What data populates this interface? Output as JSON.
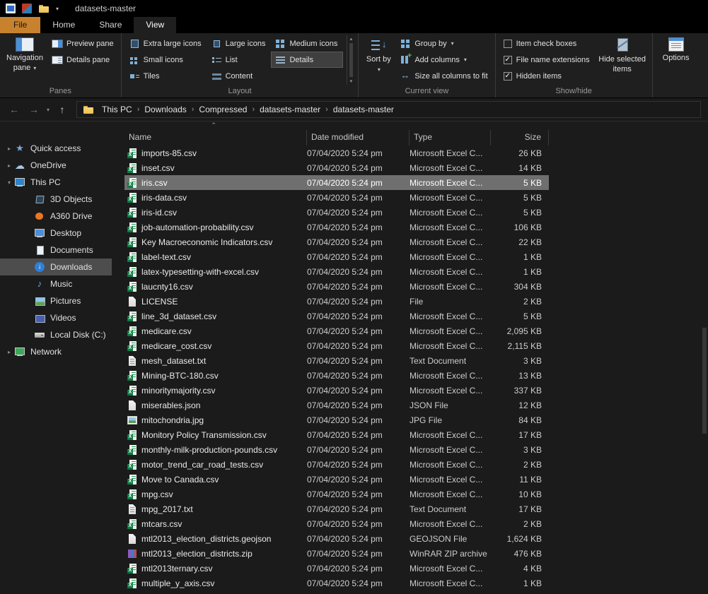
{
  "titlebar": {
    "title": "datasets-master"
  },
  "icons": {
    "back": "←",
    "forward": "→",
    "up": "↑",
    "dropdown": "▾",
    "crumb_sep": "›",
    "tree_down": "▾",
    "tree_right": "▸",
    "sort_asc": "ˆ",
    "check": "✓",
    "scroll_up": "▴",
    "scroll_down": "▾"
  },
  "ribbon": {
    "tabs": [
      {
        "label": "File",
        "style": "file"
      },
      {
        "label": "Home",
        "style": "normal"
      },
      {
        "label": "Share",
        "style": "normal"
      },
      {
        "label": "View",
        "style": "active"
      }
    ],
    "panes": {
      "label": "Panes",
      "nav_pane": "Navigation pane",
      "preview_pane": "Preview pane",
      "details_pane": "Details pane"
    },
    "layout": {
      "label": "Layout",
      "items": [
        {
          "label": "Extra large icons",
          "selected": false
        },
        {
          "label": "Large icons",
          "selected": false
        },
        {
          "label": "Medium icons",
          "selected": false
        },
        {
          "label": "Small icons",
          "selected": false
        },
        {
          "label": "List",
          "selected": false
        },
        {
          "label": "Details",
          "selected": true
        },
        {
          "label": "Tiles",
          "selected": false
        },
        {
          "label": "Content",
          "selected": false
        }
      ]
    },
    "current_view": {
      "label": "Current view",
      "sort_by": "Sort by",
      "group_by": "Group by",
      "add_columns": "Add columns",
      "size_all": "Size all columns to fit"
    },
    "show_hide": {
      "label": "Show/hide",
      "checkboxes": [
        {
          "label": "Item check boxes",
          "checked": false
        },
        {
          "label": "File name extensions",
          "checked": true
        },
        {
          "label": "Hidden items",
          "checked": true
        }
      ],
      "hide_selected": "Hide selected items"
    },
    "options": {
      "button": "Options"
    }
  },
  "address": {
    "breadcrumb": [
      "This PC",
      "Downloads",
      "Compressed",
      "datasets-master",
      "datasets-master"
    ]
  },
  "sidebar": {
    "items": [
      {
        "label": "Quick access",
        "icon": "star",
        "level": 0,
        "chevron": "right"
      },
      {
        "label": "OneDrive",
        "icon": "cloud",
        "level": 0,
        "chevron": "right"
      },
      {
        "label": "This PC",
        "icon": "pc",
        "level": 0,
        "chevron": "down"
      },
      {
        "label": "3D Objects",
        "icon": "cube",
        "level": 1
      },
      {
        "label": "A360 Drive",
        "icon": "a360",
        "level": 1
      },
      {
        "label": "Desktop",
        "icon": "desktop",
        "level": 1
      },
      {
        "label": "Documents",
        "icon": "documents",
        "level": 1
      },
      {
        "label": "Downloads",
        "icon": "downloads",
        "level": 1,
        "selected": true
      },
      {
        "label": "Music",
        "icon": "music",
        "level": 1
      },
      {
        "label": "Pictures",
        "icon": "pictures",
        "level": 1
      },
      {
        "label": "Videos",
        "icon": "videos",
        "level": 1
      },
      {
        "label": "Local Disk (C:)",
        "icon": "disk",
        "level": 1
      },
      {
        "label": "Network",
        "icon": "network",
        "level": 0,
        "chevron": "right"
      }
    ]
  },
  "filelist": {
    "columns": [
      "Name",
      "Date modified",
      "Type",
      "Size"
    ],
    "rows": [
      {
        "name": "imports-85.csv",
        "date": "07/04/2020 5:24 pm",
        "type": "Microsoft Excel C...",
        "size": "26 KB",
        "icon": "excel"
      },
      {
        "name": "inset.csv",
        "date": "07/04/2020 5:24 pm",
        "type": "Microsoft Excel C...",
        "size": "14 KB",
        "icon": "excel"
      },
      {
        "name": "iris.csv",
        "date": "07/04/2020 5:24 pm",
        "type": "Microsoft Excel C...",
        "size": "5 KB",
        "icon": "excel",
        "selected": true
      },
      {
        "name": "iris-data.csv",
        "date": "07/04/2020 5:24 pm",
        "type": "Microsoft Excel C...",
        "size": "5 KB",
        "icon": "excel"
      },
      {
        "name": "iris-id.csv",
        "date": "07/04/2020 5:24 pm",
        "type": "Microsoft Excel C...",
        "size": "5 KB",
        "icon": "excel"
      },
      {
        "name": "job-automation-probability.csv",
        "date": "07/04/2020 5:24 pm",
        "type": "Microsoft Excel C...",
        "size": "106 KB",
        "icon": "excel"
      },
      {
        "name": "Key Macroeconomic Indicators.csv",
        "date": "07/04/2020 5:24 pm",
        "type": "Microsoft Excel C...",
        "size": "22 KB",
        "icon": "excel"
      },
      {
        "name": "label-text.csv",
        "date": "07/04/2020 5:24 pm",
        "type": "Microsoft Excel C...",
        "size": "1 KB",
        "icon": "excel"
      },
      {
        "name": "latex-typesetting-with-excel.csv",
        "date": "07/04/2020 5:24 pm",
        "type": "Microsoft Excel C...",
        "size": "1 KB",
        "icon": "excel"
      },
      {
        "name": "laucnty16.csv",
        "date": "07/04/2020 5:24 pm",
        "type": "Microsoft Excel C...",
        "size": "304 KB",
        "icon": "excel"
      },
      {
        "name": "LICENSE",
        "date": "07/04/2020 5:24 pm",
        "type": "File",
        "size": "2 KB",
        "icon": "file"
      },
      {
        "name": "line_3d_dataset.csv",
        "date": "07/04/2020 5:24 pm",
        "type": "Microsoft Excel C...",
        "size": "5 KB",
        "icon": "excel"
      },
      {
        "name": "medicare.csv",
        "date": "07/04/2020 5:24 pm",
        "type": "Microsoft Excel C...",
        "size": "2,095 KB",
        "icon": "excel"
      },
      {
        "name": "medicare_cost.csv",
        "date": "07/04/2020 5:24 pm",
        "type": "Microsoft Excel C...",
        "size": "2,115 KB",
        "icon": "excel"
      },
      {
        "name": "mesh_dataset.txt",
        "date": "07/04/2020 5:24 pm",
        "type": "Text Document",
        "size": "3 KB",
        "icon": "text"
      },
      {
        "name": "Mining-BTC-180.csv",
        "date": "07/04/2020 5:24 pm",
        "type": "Microsoft Excel C...",
        "size": "13 KB",
        "icon": "excel"
      },
      {
        "name": "minoritymajority.csv",
        "date": "07/04/2020 5:24 pm",
        "type": "Microsoft Excel C...",
        "size": "337 KB",
        "icon": "excel"
      },
      {
        "name": "miserables.json",
        "date": "07/04/2020 5:24 pm",
        "type": "JSON File",
        "size": "12 KB",
        "icon": "file"
      },
      {
        "name": "mitochondria.jpg",
        "date": "07/04/2020 5:24 pm",
        "type": "JPG File",
        "size": "84 KB",
        "icon": "image"
      },
      {
        "name": "Monitory Policy Transmission.csv",
        "date": "07/04/2020 5:24 pm",
        "type": "Microsoft Excel C...",
        "size": "17 KB",
        "icon": "excel"
      },
      {
        "name": "monthly-milk-production-pounds.csv",
        "date": "07/04/2020 5:24 pm",
        "type": "Microsoft Excel C...",
        "size": "3 KB",
        "icon": "excel"
      },
      {
        "name": "motor_trend_car_road_tests.csv",
        "date": "07/04/2020 5:24 pm",
        "type": "Microsoft Excel C...",
        "size": "2 KB",
        "icon": "excel"
      },
      {
        "name": "Move to Canada.csv",
        "date": "07/04/2020 5:24 pm",
        "type": "Microsoft Excel C...",
        "size": "11 KB",
        "icon": "excel"
      },
      {
        "name": "mpg.csv",
        "date": "07/04/2020 5:24 pm",
        "type": "Microsoft Excel C...",
        "size": "10 KB",
        "icon": "excel"
      },
      {
        "name": "mpg_2017.txt",
        "date": "07/04/2020 5:24 pm",
        "type": "Text Document",
        "size": "17 KB",
        "icon": "text"
      },
      {
        "name": "mtcars.csv",
        "date": "07/04/2020 5:24 pm",
        "type": "Microsoft Excel C...",
        "size": "2 KB",
        "icon": "excel"
      },
      {
        "name": "mtl2013_election_districts.geojson",
        "date": "07/04/2020 5:24 pm",
        "type": "GEOJSON File",
        "size": "1,624 KB",
        "icon": "file"
      },
      {
        "name": "mtl2013_election_districts.zip",
        "date": "07/04/2020 5:24 pm",
        "type": "WinRAR ZIP archive",
        "size": "476 KB",
        "icon": "zip"
      },
      {
        "name": "mtl2013ternary.csv",
        "date": "07/04/2020 5:24 pm",
        "type": "Microsoft Excel C...",
        "size": "4 KB",
        "icon": "excel"
      },
      {
        "name": "multiple_y_axis.csv",
        "date": "07/04/2020 5:24 pm",
        "type": "Microsoft Excel C...",
        "size": "1 KB",
        "icon": "excel"
      }
    ]
  }
}
